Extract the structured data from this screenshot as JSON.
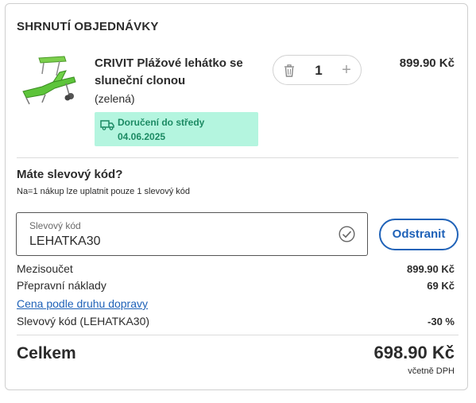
{
  "summary": {
    "title": "SHRNUTÍ OBJEDNÁVKY"
  },
  "item": {
    "name": "CRIVIT Plážové lehátko se sluneční clonou",
    "variant": "(zelená)",
    "delivery_line1": "Doručení do středy",
    "delivery_line2": "04.06.2025",
    "quantity": "1",
    "price": "899.90 Kč",
    "image_icon": "beach-lounger-image"
  },
  "promo": {
    "title": "Máte slevový kód?",
    "note": "Na=1 nákup lze uplatnit pouze 1 slevový kód",
    "field_label": "Slevový kód",
    "field_value": "LEHATKA30",
    "remove_label": "Odstranit"
  },
  "totals": {
    "subtotal_label": "Mezisoučet",
    "subtotal_value": "899.90 Kč",
    "shipping_label": "Přepravní náklady",
    "shipping_value": "69 Kč",
    "shipping_link": "Cena podle druhu dopravy",
    "discount_label": "Slevový kód (LEHATKA30)",
    "discount_value": "-30 %",
    "total_label": "Celkem",
    "total_value": "698.90 Kč",
    "vat_note": "včetně DPH"
  },
  "colors": {
    "accent_blue": "#1f62b8",
    "delivery_bg": "#b4f5df",
    "delivery_text": "#1c8a63",
    "product_green": "#5dc43a"
  }
}
